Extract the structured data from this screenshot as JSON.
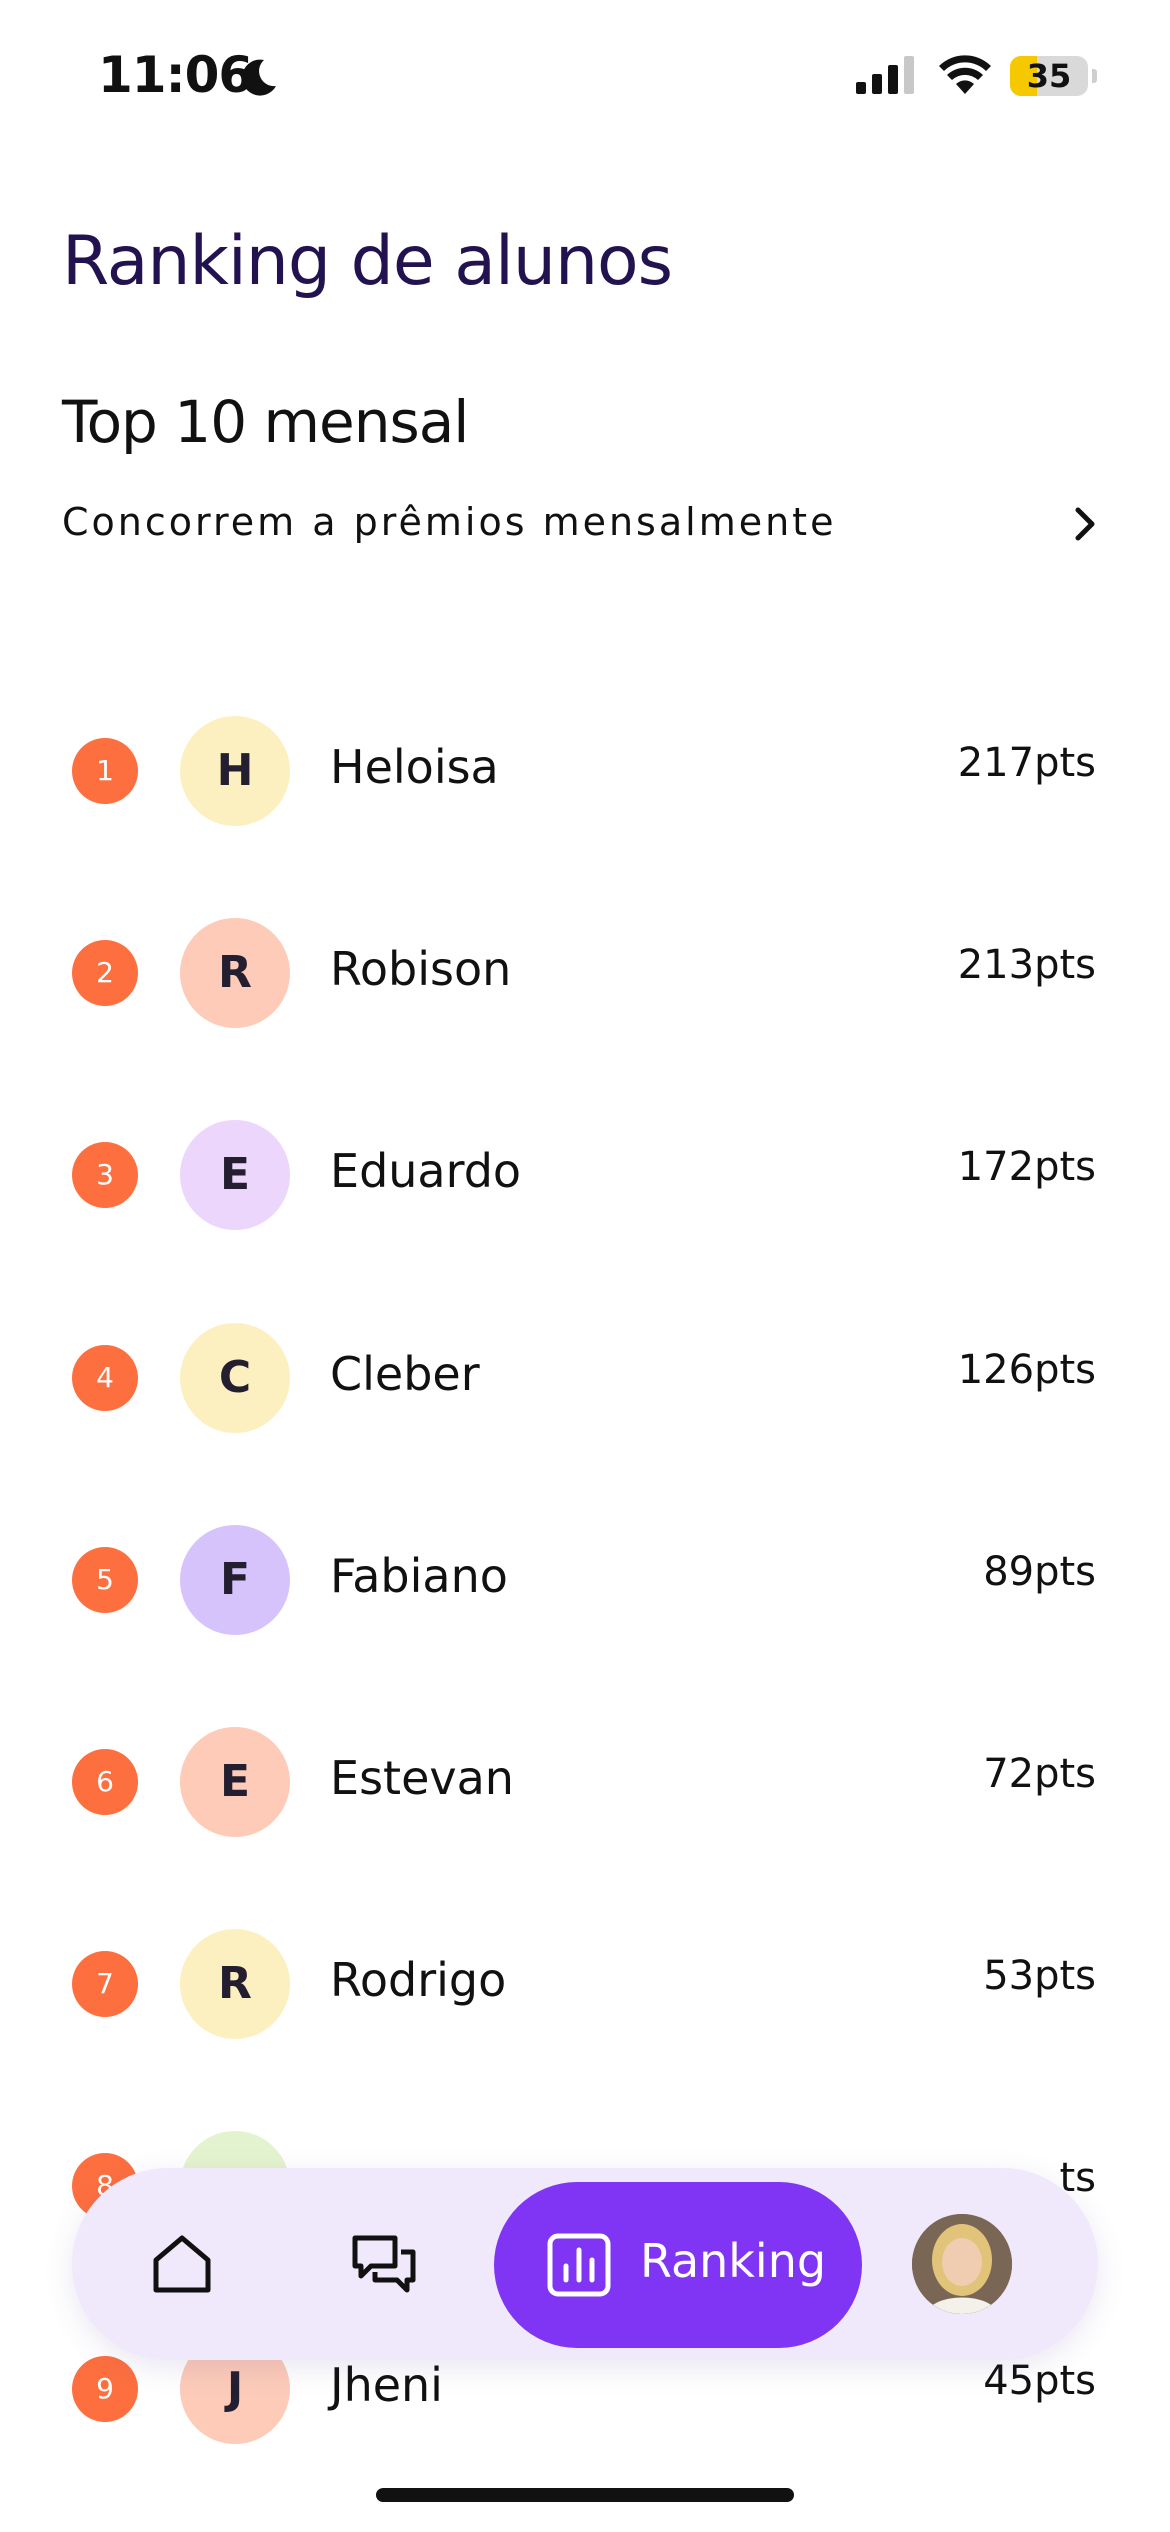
{
  "status_bar": {
    "time": "11:06",
    "battery": "35",
    "battery_level": 0.35,
    "icons": [
      "moon-icon",
      "signal-icon",
      "wifi-icon",
      "battery-icon"
    ]
  },
  "header": {
    "title": "Ranking de alunos",
    "section_title": "Top 10 mensal",
    "prizes_link": "Concorrem a prêmios mensalmente"
  },
  "ranking": [
    {
      "position": "1",
      "initial": "H",
      "name": "Heloisa",
      "points": "217pts",
      "avatar_color": "#fdf0c0"
    },
    {
      "position": "2",
      "initial": "R",
      "name": "Robison",
      "points": "213pts",
      "avatar_color": "#fdcbb8"
    },
    {
      "position": "3",
      "initial": "E",
      "name": "Eduardo",
      "points": "172pts",
      "avatar_color": "#ecd6fc"
    },
    {
      "position": "4",
      "initial": "C",
      "name": "Cleber",
      "points": "126pts",
      "avatar_color": "#fdf0c0"
    },
    {
      "position": "5",
      "initial": "F",
      "name": "Fabiano",
      "points": "89pts",
      "avatar_color": "#d7c3fc"
    },
    {
      "position": "6",
      "initial": "E",
      "name": "Estevan",
      "points": "72pts",
      "avatar_color": "#fdcbb8"
    },
    {
      "position": "7",
      "initial": "R",
      "name": "Rodrigo",
      "points": "53pts",
      "avatar_color": "#fdf0c0"
    },
    {
      "position": "8",
      "initial": "",
      "name": "",
      "points": "ts",
      "avatar_color": "#e4f3cf"
    },
    {
      "position": "9",
      "initial": "J",
      "name": "Jheni",
      "points": "45pts",
      "avatar_color": "#fdcbb8"
    }
  ],
  "nav": {
    "active_label": "Ranking",
    "items": [
      "home-icon",
      "chat-icon",
      "ranking-icon",
      "profile-avatar"
    ]
  },
  "colors": {
    "title": "#231250",
    "rank_badge": "#fd6f3f",
    "nav_background": "#efe9fb",
    "nav_active": "#8034f4"
  }
}
